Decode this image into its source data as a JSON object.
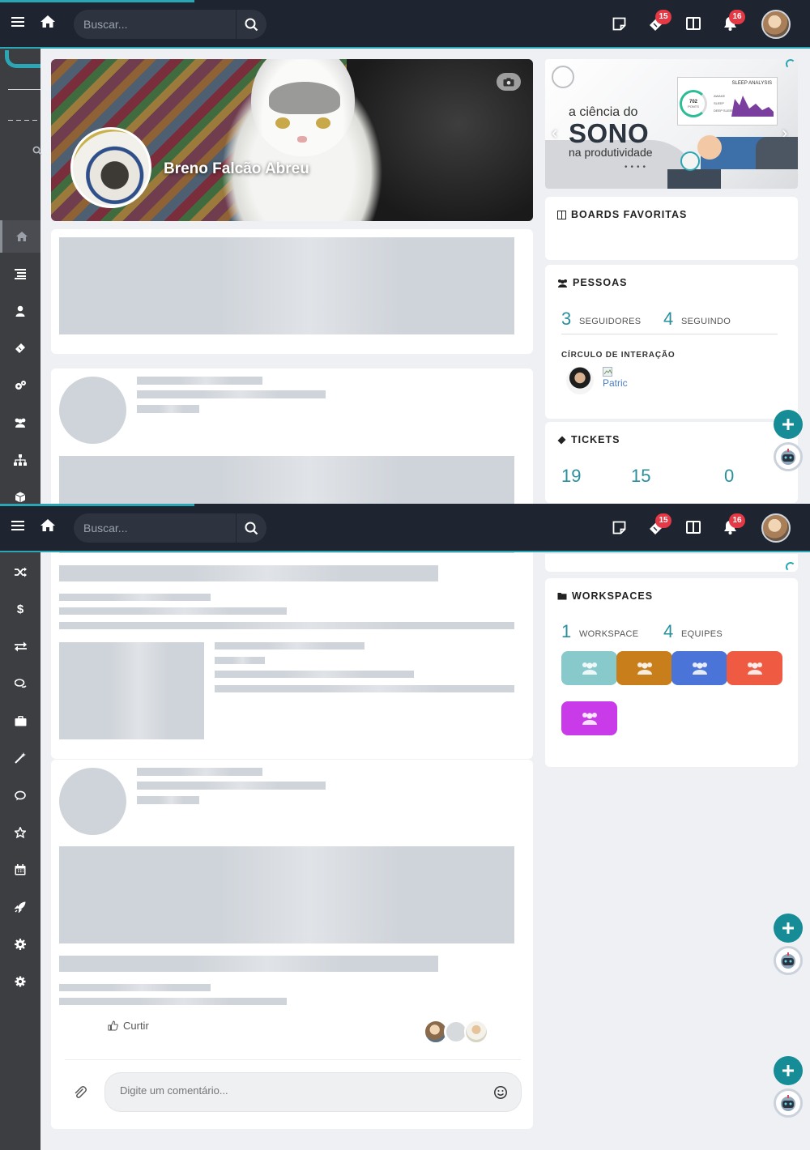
{
  "search": {
    "placeholder": "Buscar..."
  },
  "topbar": {
    "tickets_badge": "15",
    "notifications_badge": "16"
  },
  "profile": {
    "name": "Breno Falcão Abreu"
  },
  "banner": {
    "line1": "a ciência do",
    "line2": "SONO",
    "line3": "na produtividade",
    "chart_title": "SLEEP ANALYSIS",
    "score_value": "702",
    "score_label": "PONTS",
    "legend": [
      "AWAKE",
      "SLEEP",
      "DEEP SLEEP"
    ]
  },
  "boards": {
    "title": "BOARDS FAVORITAS"
  },
  "people": {
    "title": "PESSOAS",
    "followers_count": "3",
    "followers_label": "SEGUIDORES",
    "following_count": "4",
    "following_label": "SEGUINDO",
    "circle_title": "CÍRCULO DE INTERAÇÃO",
    "broken_avatar_alt": "Patric"
  },
  "tickets": {
    "title": "TICKETS",
    "stats": [
      {
        "count": "19"
      },
      {
        "count": "15"
      },
      {
        "count": "0"
      }
    ]
  },
  "workspaces": {
    "title": "WORKSPACES",
    "workspace_count": "1",
    "workspace_label": "WORKSPACE",
    "teams_count": "4",
    "teams_label": "EQUIPES",
    "colors": [
      "#88c9cc",
      "#c97e1c",
      "#4a74d8",
      "#ef5a42",
      "#c93be8"
    ]
  },
  "post": {
    "like_label": "Curtir",
    "comment_placeholder": "Digite um comentário..."
  },
  "colors": {
    "accent": "#2aa6b4",
    "topbar": "#1f2530",
    "sidebar": "#3c3e42",
    "badge": "#e53946"
  },
  "sidebar_icons": [
    "home-icon",
    "list-icon",
    "user-icon",
    "ticket-icon",
    "cogs-icon",
    "users-icon",
    "sitemap-icon",
    "cube-icon",
    "shuffle-icon",
    "dollar-icon",
    "exchange-icon",
    "comments-icon",
    "briefcase-icon",
    "magic-icon",
    "comment-icon",
    "star-icon",
    "calendar-icon",
    "rocket-icon",
    "gear-icon",
    "settings-icon"
  ]
}
